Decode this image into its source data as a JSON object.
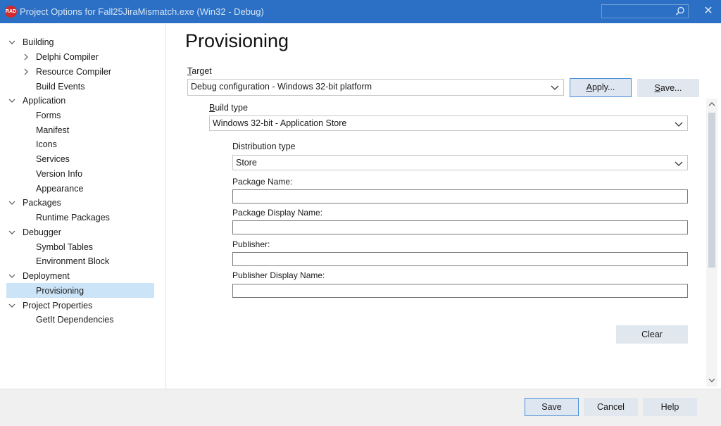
{
  "window": {
    "title": "Project Options for Fall25JiraMismatch.exe  (Win32 - Debug)",
    "logo_text": "RAD",
    "search_placeholder": "",
    "close_glyph": "✕"
  },
  "tree": {
    "items": [
      {
        "label": "Building",
        "level": 0,
        "expander": "expanded"
      },
      {
        "label": "Delphi Compiler",
        "level": 1,
        "expander": "collapsed"
      },
      {
        "label": "Resource Compiler",
        "level": 1,
        "expander": "collapsed"
      },
      {
        "label": "Build Events",
        "level": 1,
        "expander": "none"
      },
      {
        "label": "Application",
        "level": 0,
        "expander": "expanded"
      },
      {
        "label": "Forms",
        "level": 1,
        "expander": "none"
      },
      {
        "label": "Manifest",
        "level": 1,
        "expander": "none"
      },
      {
        "label": "Icons",
        "level": 1,
        "expander": "none"
      },
      {
        "label": "Services",
        "level": 1,
        "expander": "none"
      },
      {
        "label": "Version Info",
        "level": 1,
        "expander": "none"
      },
      {
        "label": "Appearance",
        "level": 1,
        "expander": "none"
      },
      {
        "label": "Packages",
        "level": 0,
        "expander": "expanded"
      },
      {
        "label": "Runtime Packages",
        "level": 1,
        "expander": "none"
      },
      {
        "label": "Debugger",
        "level": 0,
        "expander": "expanded"
      },
      {
        "label": "Symbol Tables",
        "level": 1,
        "expander": "none"
      },
      {
        "label": "Environment Block",
        "level": 1,
        "expander": "none"
      },
      {
        "label": "Deployment",
        "level": 0,
        "expander": "expanded"
      },
      {
        "label": "Provisioning",
        "level": 1,
        "expander": "none",
        "selected": true
      },
      {
        "label": "Project Properties",
        "level": 0,
        "expander": "expanded"
      },
      {
        "label": "GetIt Dependencies",
        "level": 1,
        "expander": "none"
      }
    ]
  },
  "main": {
    "title": "Provisioning",
    "target": {
      "label_first": "T",
      "label_rest": "arget",
      "value": "Debug configuration - Windows 32-bit platform",
      "apply_first": "A",
      "apply_rest": "pply...",
      "save_first": "S",
      "save_rest": "ave..."
    },
    "build_type": {
      "label_first": "B",
      "label_rest": "uild type",
      "value": "Windows 32-bit - Application Store"
    },
    "distribution": {
      "label": "Distribution type",
      "value": "Store"
    },
    "fields": {
      "package_name": "Package Name:",
      "package_display_name": "Package Display Name:",
      "publisher": "Publisher:",
      "publisher_display_name": "Publisher Display Name:"
    },
    "clear_label": "Clear"
  },
  "footer": {
    "save_label": "Save",
    "cancel_label": "Cancel",
    "help_label": "Help"
  },
  "colors": {
    "titlebar": "#2b70c5",
    "selection": "#cce4f7",
    "button": "#e1e7ef",
    "default_button_border": "#4a90d9"
  }
}
